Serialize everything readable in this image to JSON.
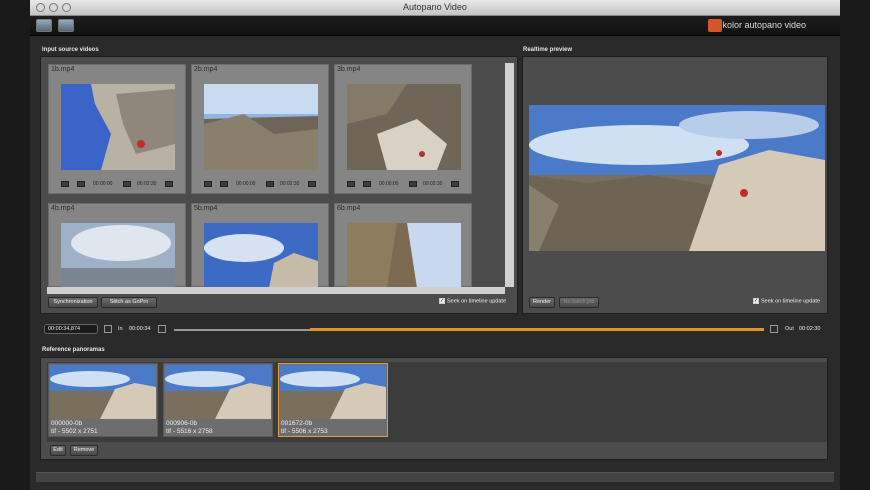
{
  "window": {
    "title": "Autopano Video"
  },
  "toolbar": {
    "brand": "kolor autopano video",
    "icons": [
      "open-videos-icon",
      "import-icon"
    ]
  },
  "input_source": {
    "label": "Input source videos",
    "videos": [
      {
        "name": "1b.mp4",
        "time_current": "00:00:00",
        "time_total": "00:02:30"
      },
      {
        "name": "2b.mp4",
        "time_current": "00:00:00",
        "time_total": "00:02:30"
      },
      {
        "name": "3b.mp4",
        "time_current": "00:00:00",
        "time_total": "00:02:30"
      },
      {
        "name": "4b.mp4"
      },
      {
        "name": "5b.mp4"
      },
      {
        "name": "6b.mp4"
      }
    ],
    "buttons": {
      "synchronization": "Synchronization",
      "stitch": "Stitch  as GoPro"
    },
    "seek_checkbox": "Seek on timeline update"
  },
  "realtime_preview": {
    "label": "Realtime preview",
    "buttons": {
      "render": "Render",
      "no_batch": "No batch job"
    },
    "seek_checkbox": "Seek on timeline update"
  },
  "timeline": {
    "timecode": "00:00:34,874",
    "in_label": "In",
    "in_time": "00:00:34",
    "out_label": "Out",
    "out_time": "00:02:30",
    "progress": 0.23
  },
  "reference": {
    "label": "Reference panoramas",
    "items": [
      {
        "name": "000000-0b",
        "info": "tif - 5502 x 2751"
      },
      {
        "name": "000906-0b",
        "info": "tif - 5516 x 2758"
      },
      {
        "name": "001672-0b",
        "info": "tif - 5506 x 2753"
      }
    ],
    "buttons": {
      "edit": "Edit",
      "remove": "Remove"
    }
  },
  "colors": {
    "accent": "#e0952b",
    "panel": "#4c4c4c",
    "background": "#2a2a2a"
  }
}
